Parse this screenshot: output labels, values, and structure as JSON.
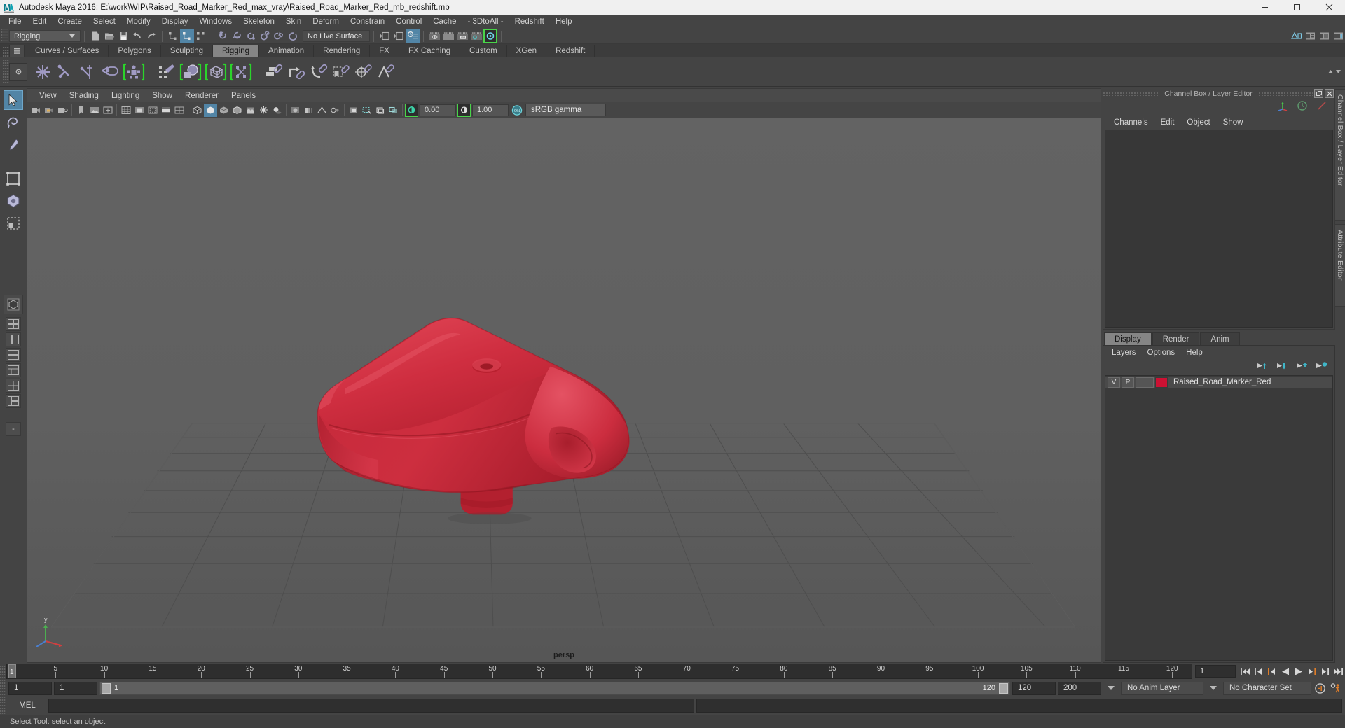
{
  "window": {
    "title": "Autodesk Maya 2016: E:\\work\\WIP\\Raised_Road_Marker_Red_max_vray\\Raised_Road_Marker_Red_mb_redshift.mb",
    "minimize_label": "Minimize",
    "maximize_label": "Maximize",
    "close_label": "Close",
    "app_icon": "maya-icon"
  },
  "menubar": {
    "items": [
      "File",
      "Edit",
      "Create",
      "Select",
      "Modify",
      "Display",
      "Windows",
      "Skeleton",
      "Skin",
      "Deform",
      "Constrain",
      "Control",
      "Cache",
      "- 3DtoAll -",
      "Redshift",
      "Help"
    ]
  },
  "statusline_toolbar": {
    "menu_set": "Rigging",
    "live_surface": "No Live Surface",
    "icons": [
      "new-scene-icon",
      "open-scene-icon",
      "save-scene-icon",
      "undo-icon",
      "redo-icon",
      "select-by-hierarchy-icon",
      "select-by-object-icon",
      "select-by-component-icon",
      "snap-to-grid-icon",
      "snap-to-curve-icon",
      "snap-to-point-icon",
      "snap-to-projected-center-icon",
      "snap-to-view-plane-icon",
      "make-live-icon",
      "open-render-view-icon",
      "render-current-frame-icon",
      "ipr-render-icon",
      "render-settings-icon",
      "toggle-editor-icon",
      "show-hide-modeling-toolkit-icon",
      "show-hide-attribute-editor-icon",
      "show-hide-tool-settings-icon",
      "show-hide-channel-box-icon"
    ]
  },
  "shelf": {
    "tabs": [
      "Curves / Surfaces",
      "Polygons",
      "Sculpting",
      "Rigging",
      "Animation",
      "Rendering",
      "FX",
      "FX Caching",
      "Custom",
      "XGen",
      "Redshift"
    ],
    "active_tab": "Rigging",
    "icons": [
      "create-joint-icon",
      "create-ik-handle-icon",
      "create-ik-spline-handle-icon",
      "insert-joint-icon",
      "quick-rig-icon",
      "paint-skin-weights-icon",
      "bind-skin-icon",
      "lattice-deformer-icon",
      "cluster-deformer-icon",
      "parent-constraint-icon",
      "point-constraint-icon",
      "orient-constraint-icon",
      "scale-constraint-icon",
      "aim-constraint-icon",
      "pole-vector-constraint-icon",
      "create-set-icon",
      "create-partition-icon"
    ]
  },
  "toolbox": {
    "tools": [
      {
        "name": "select-tool",
        "active": true
      },
      {
        "name": "lasso-select-tool",
        "active": false
      },
      {
        "name": "paint-select-tool",
        "active": false
      },
      {
        "name": "move-tool",
        "active": false
      },
      {
        "name": "rotate-tool",
        "active": false
      },
      {
        "name": "scale-tool",
        "active": false
      },
      {
        "name": "last-tool-used",
        "active": false
      }
    ],
    "layout_presets": [
      "single-perspective-layout",
      "four-view-layout",
      "persp-outliner-layout",
      "persp-graph-editor-layout",
      "hypershade-persp-layout",
      "persp-uv-editor-layout",
      "outliner-persp-graph-layout"
    ],
    "minimize_label": "-"
  },
  "viewport": {
    "menu": [
      "View",
      "Shading",
      "Lighting",
      "Show",
      "Renderer",
      "Panels"
    ],
    "camera_label": "persp",
    "exposure_value": "0.00",
    "gamma_value": "1.00",
    "color_management": "sRGB gamma",
    "color_management_on_label": "ON",
    "toolbar_icons": [
      "select-camera-icon",
      "lock-camera-icon",
      "camera-attributes-icon",
      "bookmark-icon",
      "image-plane-icon",
      "two-d-pan-zoom-icon",
      "grid-toggle-icon",
      "film-gate-icon",
      "resolution-gate-icon",
      "gate-mask-icon",
      "film-origin-icon",
      "wireframe-icon",
      "smooth-shade-all-icon",
      "smooth-shade-selected-icon",
      "shaded-wireframe-icon",
      "textured-icon",
      "use-lights-icon",
      "shadows-icon",
      "screen-space-ao-icon",
      "motion-blur-icon",
      "multisample-aa-icon",
      "depth-of-field-icon",
      "isolate-select-icon",
      "xray-icon",
      "xray-joints-icon",
      "xray-active-components-icon",
      "exposure-icon",
      "gamma-icon",
      "color-management-toggle-icon"
    ],
    "model": {
      "name": "Raised_Road_Marker_Red",
      "color": "#cd2233"
    }
  },
  "right_panel": {
    "header_title": "Channel Box / Layer Editor",
    "header_buttons": [
      "undock-icon",
      "close-icon"
    ],
    "quick_icons": [
      "axis-gizmo-icon",
      "clock-icon",
      "red-line-icon"
    ],
    "channelbox_menu": [
      "Channels",
      "Edit",
      "Object",
      "Show"
    ],
    "layer_tabs": [
      "Display",
      "Render",
      "Anim"
    ],
    "active_layer_tab": "Display",
    "layer_menu": [
      "Layers",
      "Options",
      "Help"
    ],
    "layer_buttons": [
      "move-layer-up-icon",
      "move-layer-down-icon",
      "new-layer-icon",
      "new-layer-from-selected-icon"
    ],
    "layers": [
      {
        "visibility": "V",
        "playback": "P",
        "shading": "",
        "color": "#cc1133",
        "name": "Raised_Road_Marker_Red"
      }
    ],
    "dock_tabs": [
      "Channel Box / Layer Editor",
      "Attribute Editor"
    ]
  },
  "timeline": {
    "start_frame": "1",
    "current_frame": "1",
    "end_frame": "120",
    "tick_labels": [
      "5",
      "10",
      "15",
      "20",
      "25",
      "30",
      "35",
      "40",
      "45",
      "50",
      "55",
      "60",
      "65",
      "70",
      "75",
      "80",
      "85",
      "90",
      "95",
      "100",
      "105",
      "110",
      "115",
      "120"
    ],
    "playback_buttons": [
      "go-to-start-icon",
      "step-back-frame-icon",
      "step-back-key-icon",
      "play-backwards-icon",
      "play-forwards-icon",
      "step-forward-key-icon",
      "step-forward-frame-icon",
      "go-to-end-icon"
    ]
  },
  "range_slider": {
    "anim_start": "1",
    "range_start": "1",
    "bar_value": "1",
    "bar_end": "120",
    "range_end": "120",
    "anim_end": "200",
    "anim_layer": "No Anim Layer",
    "character_set": "No Character Set",
    "auto_key_icon": "auto-keyframe-icon",
    "anim_prefs_icon": "animation-preferences-icon"
  },
  "command_line": {
    "language_label": "MEL",
    "input_value": "",
    "output_value": ""
  },
  "status_bar": {
    "message": "Select Tool: select an object"
  }
}
